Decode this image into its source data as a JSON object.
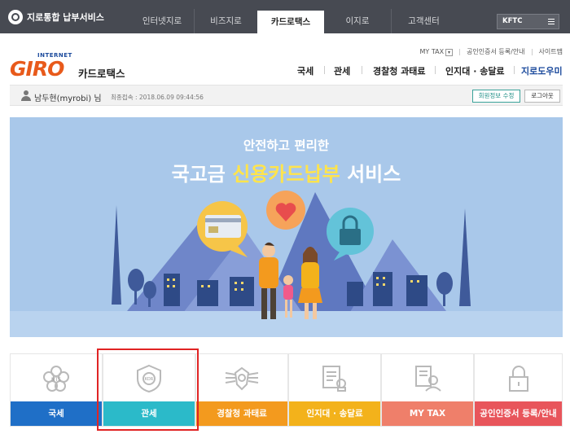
{
  "topbar": {
    "brand": "지로통합 납부서비스",
    "tabs": [
      {
        "label": "인터넷지로"
      },
      {
        "label": "비즈지로"
      },
      {
        "label": "카드로택스"
      },
      {
        "label": "이지로"
      },
      {
        "label": "고객센터"
      }
    ],
    "active_tab": "카드로택스",
    "kftc_label": "KFTC"
  },
  "header": {
    "logo_internet": "INTERNET",
    "logo_giro": "GIRO",
    "logo_service": "카드로택스",
    "util_links": [
      "MY TAX",
      "공인인증서 등록/안내",
      "사이트맵"
    ],
    "gnb": [
      "국세",
      "관세",
      "경찰청 과태료",
      "인지대 · 송달료",
      "지로도우미"
    ]
  },
  "user": {
    "name": "남두현(myrobi) 님",
    "last_login": "최종접속 : 2018.06.09 09:44:56",
    "edit_button": "회원정보 수정",
    "logout_button": "로그아웃"
  },
  "banner": {
    "line1": "안전하고 편리한",
    "line2_prefix": "국고금 ",
    "line2_highlight": "신용카드납부",
    "line2_suffix": " 서비스"
  },
  "services": [
    {
      "label": "국세",
      "icon": "nts-flower-icon",
      "color": "#1f6fc7"
    },
    {
      "label": "관세",
      "icon": "customs-shield-icon",
      "color": "#2bbac9"
    },
    {
      "label": "경찰청 과태료",
      "icon": "police-badge-icon",
      "color": "#f39a1e"
    },
    {
      "label": "인지대 · 송달료",
      "icon": "stamp-document-icon",
      "color": "#f3b21b"
    },
    {
      "label": "MY TAX",
      "icon": "user-document-icon",
      "color": "#ef7f6a"
    },
    {
      "label": "공인인증서 등록/안내",
      "icon": "padlock-icon",
      "color": "#e8555b"
    }
  ],
  "colors": {
    "topbar": "#474a52",
    "brand_blue": "#1b4a9c",
    "banner_sky": "#a9c8ea",
    "highlight_box": "#e02424"
  }
}
